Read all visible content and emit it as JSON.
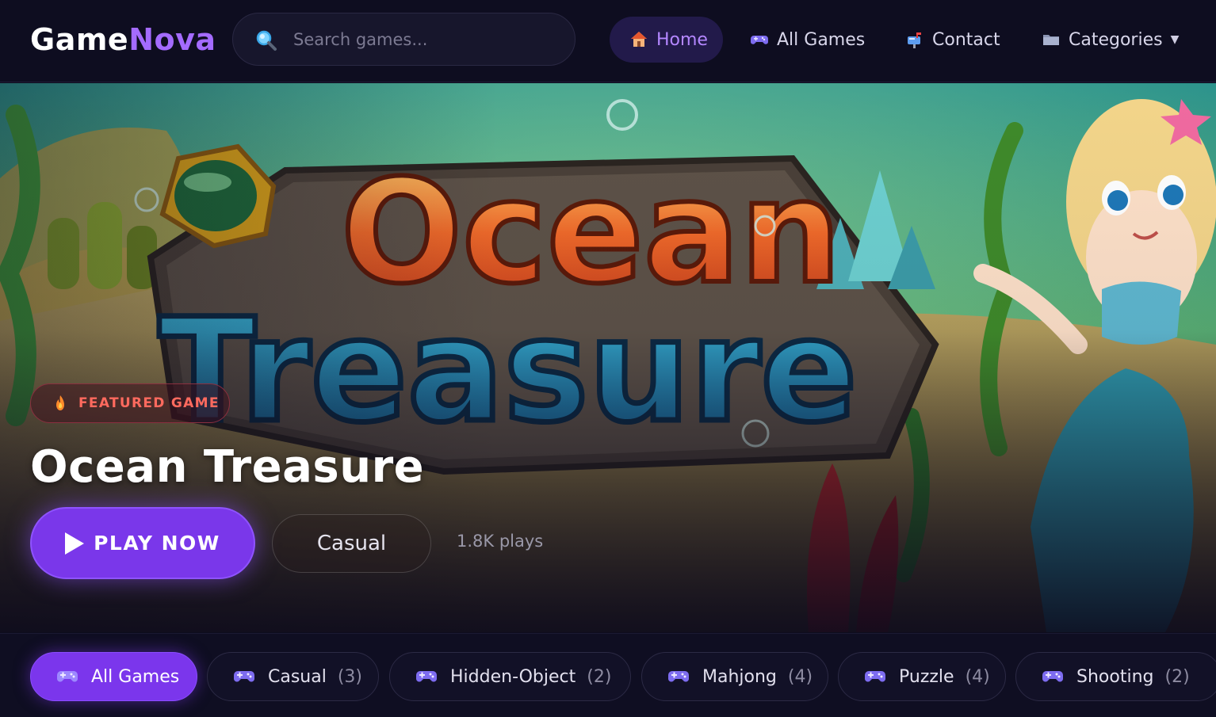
{
  "brand": {
    "name_part1": "Game",
    "name_part2": "Nova",
    "accent": "#a46bff"
  },
  "search": {
    "placeholder": "Search games...",
    "value": ""
  },
  "nav": {
    "items": [
      {
        "label": "Home",
        "icon": "house-icon",
        "active": true
      },
      {
        "label": "All Games",
        "icon": "gamepad-icon",
        "active": false
      },
      {
        "label": "Contact",
        "icon": "mailbox-icon",
        "active": false
      },
      {
        "label": "Categories",
        "icon": "folder-icon",
        "active": false,
        "dropdown": true
      }
    ]
  },
  "hero": {
    "badge": "FEATURED GAME",
    "title": "Ocean Treasure",
    "play_label": "PLAY NOW",
    "genre": "Casual",
    "plays": "1.8K plays"
  },
  "categories": [
    {
      "label": "All Games",
      "count": "",
      "active": true,
      "icon": "gamepad-icon"
    },
    {
      "label": "Casual",
      "count": "(3)",
      "active": false,
      "icon": "gamepad-icon"
    },
    {
      "label": "Hidden-Object",
      "count": "(2)",
      "active": false,
      "icon": "gamepad-icon"
    },
    {
      "label": "Mahjong",
      "count": "(4)",
      "active": false,
      "icon": "gamepad-icon"
    },
    {
      "label": "Puzzle",
      "count": "(4)",
      "active": false,
      "icon": "gamepad-icon"
    },
    {
      "label": "Shooting",
      "count": "(2)",
      "active": false,
      "icon": "gamepad-icon"
    }
  ],
  "colors": {
    "primary": "#7b36ec",
    "background": "#0d0c1d",
    "badge_text": "#ff6a5e"
  }
}
